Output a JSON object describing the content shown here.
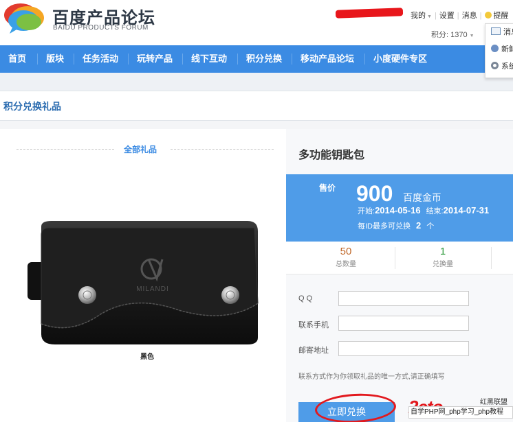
{
  "header": {
    "brand_cn": "百度产品论坛",
    "brand_en": "BAIDU PRODUCTS FORUM",
    "user_links": [
      {
        "label": "我的",
        "has_caret": true
      },
      {
        "label": "设置"
      },
      {
        "label": "消息"
      },
      {
        "label": "提醒"
      }
    ],
    "points_label": "积分: 1370",
    "dropdown": [
      "消息",
      "新鲜事",
      "系统"
    ]
  },
  "nav": {
    "items": [
      "首页",
      "版块",
      "任务活动",
      "玩转产品",
      "线下互动",
      "积分兑换",
      "移动产品论坛",
      "小度硬件专区"
    ]
  },
  "page": {
    "title": "积分兑换礼品"
  },
  "left": {
    "category_label": "全部礼品",
    "color_label": "黑色",
    "product_brand_text": "MILANDI"
  },
  "product": {
    "title": "多功能钥匙包",
    "price_label": "售价",
    "price": "900",
    "price_unit": "百度金币",
    "start_label": "开始:",
    "start_date": "2014-05-16",
    "end_label": "结束:",
    "end_date": "2014-07-31",
    "limit_prefix": "每ID最多可兑换",
    "limit_value": "2",
    "limit_suffix": "个",
    "stats": [
      {
        "num": "50",
        "label": "总数量",
        "color": "#c0682a"
      },
      {
        "num": "1",
        "label": "兑换量",
        "color": "#2f9a3c"
      }
    ]
  },
  "form": {
    "fields": [
      {
        "label": "Q Q",
        "value": ""
      },
      {
        "label": "联系手机",
        "value": ""
      },
      {
        "label": "邮寄地址",
        "value": ""
      }
    ],
    "note": "联系方式作为你领取礼品的唯一方式,请正确填写",
    "submit_label": "立即兑换"
  },
  "watermark": {
    "logo_text": "2cto",
    "small_text": "红黑联盟",
    "bar_text": "自学PHP网_php学习_php教程"
  },
  "colors": {
    "nav": "#3b8be3",
    "price_box": "#4f9ce8",
    "annotation_red": "#e2191e",
    "title_blue": "#2b6cb0"
  }
}
